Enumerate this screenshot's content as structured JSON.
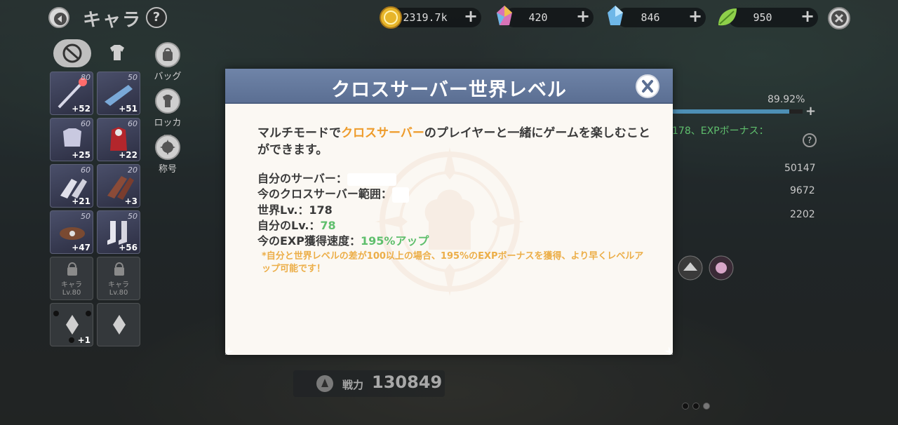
{
  "header": {
    "title": "キャラ",
    "help_label": "?"
  },
  "currencies": [
    {
      "name": "gold-coin",
      "value": "2319.7k",
      "color": "#e7b52a"
    },
    {
      "name": "rainbow-crystal",
      "value": "420",
      "color": "#d873b8"
    },
    {
      "name": "blue-crystal",
      "value": "846",
      "color": "#6fb7e8"
    },
    {
      "name": "green-leaf",
      "value": "950",
      "color": "#8ed04a"
    }
  ],
  "side_menu": [
    {
      "label": "バッグ",
      "icon": "bag-icon"
    },
    {
      "label": "ロッカー",
      "icon": "locker-icon"
    },
    {
      "label": "称号",
      "icon": "title-emblem-icon"
    }
  ],
  "equipment": [
    {
      "level": "80",
      "enhance": "+52",
      "icon": "staff-icon"
    },
    {
      "level": "50",
      "enhance": "+51",
      "icon": "gun-icon"
    },
    {
      "level": "60",
      "enhance": "+25",
      "icon": "armor-icon"
    },
    {
      "level": "60",
      "enhance": "+22",
      "icon": "outfit-icon"
    },
    {
      "level": "60",
      "enhance": "+21",
      "icon": "gloves-icon"
    },
    {
      "level": "20",
      "enhance": "+3",
      "icon": "gauntlet-icon"
    },
    {
      "level": "50",
      "enhance": "+47",
      "icon": "belt-icon"
    },
    {
      "level": "50",
      "enhance": "+56",
      "icon": "boots-icon"
    }
  ],
  "locked_slots": [
    {
      "label": "キャラ",
      "sub": "Lv.80"
    },
    {
      "label": "キャラ",
      "sub": "Lv.80"
    }
  ],
  "emblem_slots": [
    {
      "badge": "+1"
    },
    {
      "badge": ""
    }
  ],
  "right_panel": {
    "exp_percent_label": "89.92%",
    "exp_fraction": 0.8992,
    "bonus_text": "178、EXPボーナス：",
    "stats": [
      "50147",
      "9672",
      "2202"
    ]
  },
  "modal": {
    "title": "クロスサーバー世界レベル",
    "desc_part1": "マルチモードで",
    "desc_highlight": "クロスサーバー",
    "desc_part2": "のプレイヤーと一緒にゲームを楽しむことができます。",
    "own_server_label": "自分のサーバー：",
    "cross_range_label": "今のクロスサーバー範囲：",
    "world_lv_label": "世界Lv.：",
    "world_lv_value": "178",
    "own_lv_label": "自分のLv.：",
    "own_lv_value": "78",
    "exp_speed_label": "今のEXP獲得速度：",
    "exp_speed_value": "195%アップ",
    "note": "*自分と世界レベルの差が100以上の場合、195%のEXPボーナスを獲得、より早くレベルアップ可能です！"
  },
  "power": {
    "label": "戦力",
    "value": "130849"
  }
}
